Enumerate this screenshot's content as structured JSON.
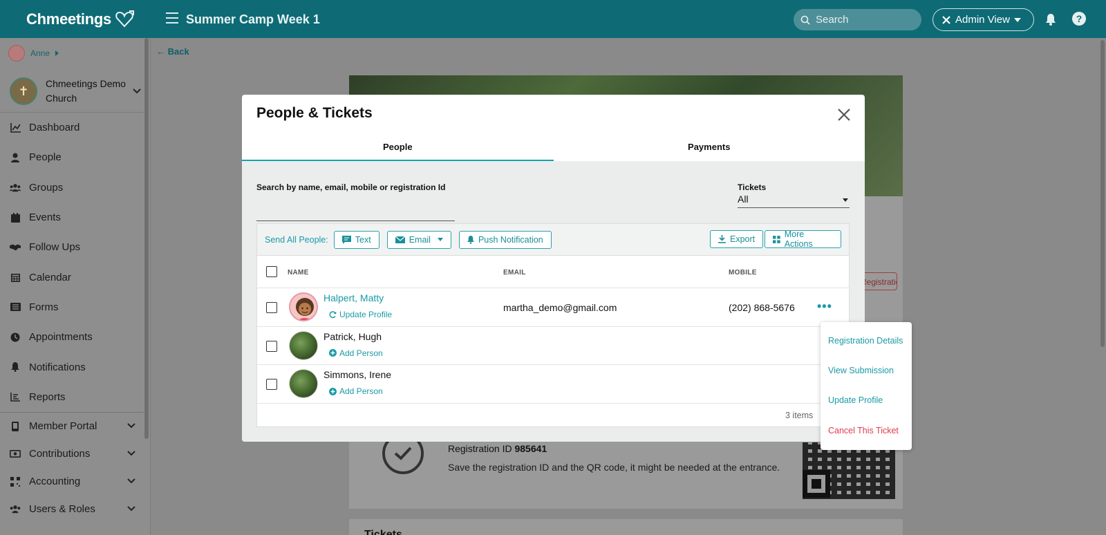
{
  "app": {
    "logo_text": "Chmeetings",
    "event_title": "Summer Camp Week 1",
    "search_placeholder": "Search",
    "admin_view_label": "Admin View"
  },
  "sidebar": {
    "user_name": "Anne",
    "church_name": "Chmeetings Demo Church",
    "items": [
      {
        "label": "Dashboard",
        "icon": "chart-line-icon"
      },
      {
        "label": "People",
        "icon": "person-icon"
      },
      {
        "label": "Groups",
        "icon": "users-icon"
      },
      {
        "label": "Events",
        "icon": "calendar-icon"
      },
      {
        "label": "Follow Ups",
        "icon": "handshake-icon"
      },
      {
        "label": "Calendar",
        "icon": "calendar-grid-icon"
      },
      {
        "label": "Forms",
        "icon": "list-icon"
      },
      {
        "label": "Appointments",
        "icon": "clock-icon"
      },
      {
        "label": "Notifications",
        "icon": "bell-icon"
      },
      {
        "label": "Reports",
        "icon": "bar-chart-icon"
      }
    ],
    "groups": [
      {
        "label": "Member Portal",
        "icon": "mobile-icon"
      },
      {
        "label": "Contributions",
        "icon": "money-icon"
      },
      {
        "label": "Accounting",
        "icon": "grid-icon"
      },
      {
        "label": "Users & Roles",
        "icon": "users-icon"
      }
    ]
  },
  "page": {
    "back_label": "Back",
    "registration_tag": "Registration",
    "registration_id_label": "Registration ID",
    "registration_id": "985641",
    "save_note": "Save the registration ID and the QR code, it might be needed at the entrance.",
    "tickets_heading": "Tickets"
  },
  "modal": {
    "title": "People & Tickets",
    "tabs": [
      "People",
      "Payments"
    ],
    "search_label": "Search by name, email, mobile or registration Id",
    "tickets_label": "Tickets",
    "tickets_value": "All",
    "send_all_label": "Send All People:",
    "buttons": {
      "text": "Text",
      "email": "Email",
      "push": "Push Notification",
      "export": "Export",
      "more_actions": "More Actions"
    },
    "columns": {
      "name": "NAME",
      "email": "EMAIL",
      "mobile": "MOBILE"
    },
    "rows": [
      {
        "name": "Halpert, Matty",
        "action": "Update Profile",
        "email": "martha_demo@gmail.com",
        "mobile": "(202) 868-5676"
      },
      {
        "name": "Patrick, Hugh",
        "action": "Add Person",
        "email": "",
        "mobile": ""
      },
      {
        "name": "Simmons, Irene",
        "action": "Add Person",
        "email": "",
        "mobile": ""
      }
    ],
    "items_count": "3 items"
  },
  "row_menu": {
    "items": [
      "Registration Details",
      "View Submission",
      "Update Profile",
      "Cancel This Ticket"
    ]
  },
  "colors": {
    "brand": "#0e6b75",
    "accent": "#1a9aa6",
    "danger": "#e23b4a"
  }
}
